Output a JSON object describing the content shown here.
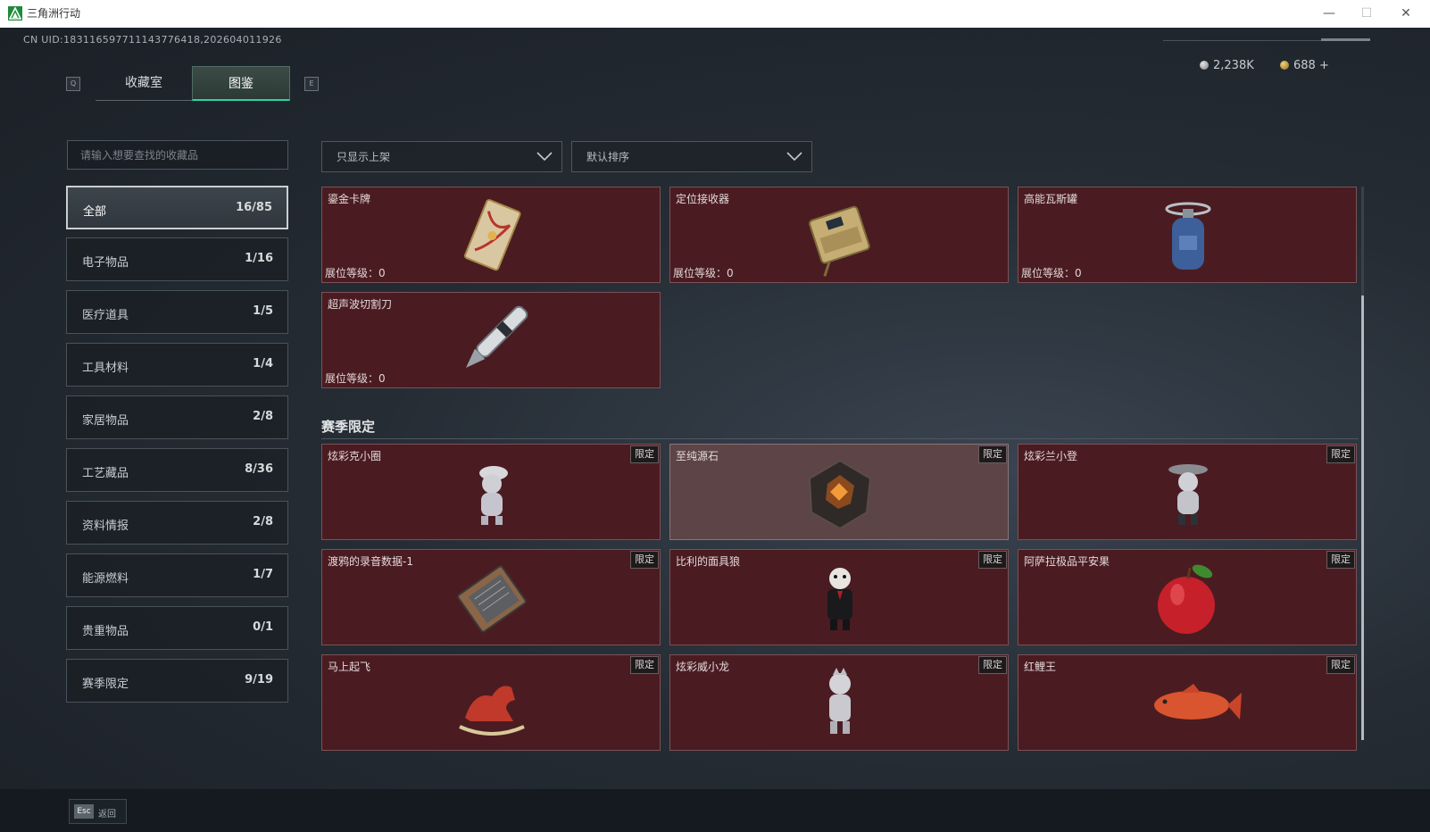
{
  "window": {
    "title": "三角洲行动",
    "min": "—",
    "max": "☐",
    "close": "✕"
  },
  "header": {
    "uid": "CN UID:183116597711143776418,202604011926",
    "currency": [
      {
        "amount": "2,238K"
      },
      {
        "amount": "688 +"
      }
    ]
  },
  "tabs": {
    "left_key": "Q",
    "right_key": "E",
    "items": [
      {
        "label": "收藏室"
      },
      {
        "label": "图鉴"
      }
    ],
    "active": "图鉴"
  },
  "search": {
    "placeholder": "请输入想要查找的收藏品"
  },
  "categories": [
    {
      "label": "全部",
      "count": "16/85"
    },
    {
      "label": "电子物品",
      "count": "1/16"
    },
    {
      "label": "医疗道具",
      "count": "1/5"
    },
    {
      "label": "工具材料",
      "count": "1/4"
    },
    {
      "label": "家居物品",
      "count": "2/8"
    },
    {
      "label": "工艺藏品",
      "count": "8/36"
    },
    {
      "label": "资料情报",
      "count": "2/8"
    },
    {
      "label": "能源燃料",
      "count": "1/7"
    },
    {
      "label": "贵重物品",
      "count": "0/1"
    },
    {
      "label": "赛季限定",
      "count": "9/19"
    }
  ],
  "filters": {
    "show_filter": "只显示上架",
    "sort": "默认排序"
  },
  "items": [
    {
      "name": "鎏金卡牌",
      "level": "展位等级：0"
    },
    {
      "name": "定位接收器",
      "level": "展位等级：0"
    },
    {
      "name": "高能瓦斯罐",
      "level": "展位等级：0"
    },
    {
      "name": "超声波切割刀",
      "level": "展位等级：0"
    }
  ],
  "season": {
    "title": "赛季限定",
    "badge": "限定",
    "items": [
      {
        "name": "炫彩克小圈"
      },
      {
        "name": "至纯源石"
      },
      {
        "name": "炫彩兰小登"
      },
      {
        "name": "渡鸦的录音数据-1"
      },
      {
        "name": "比利的面具狼"
      },
      {
        "name": "阿萨拉极品平安果"
      },
      {
        "name": "马上起飞"
      },
      {
        "name": "炫彩威小龙"
      },
      {
        "name": "红鲤王"
      }
    ]
  },
  "footer": {
    "key": "Esc",
    "label": "返回"
  }
}
